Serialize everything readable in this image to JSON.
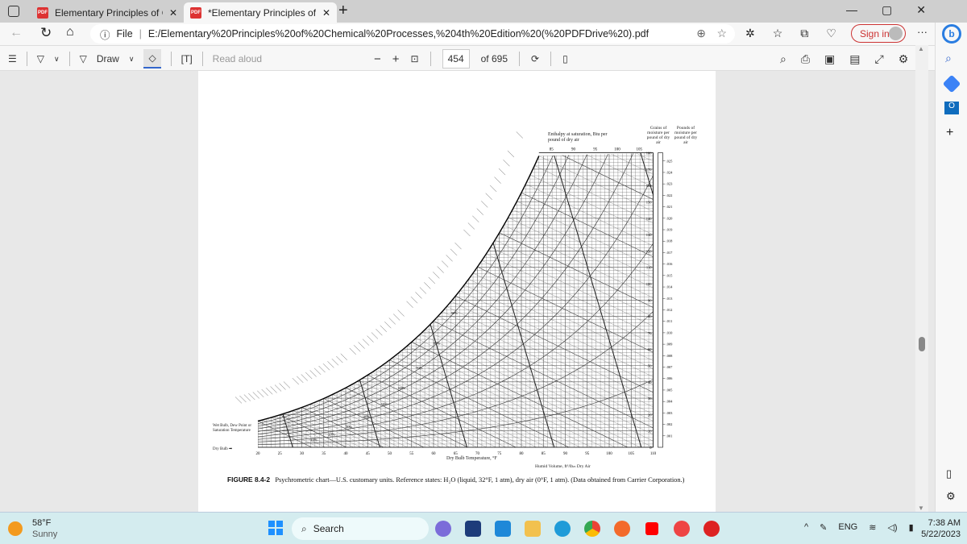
{
  "tabs": [
    {
      "label": "Elementary Principles of Chemica",
      "active": false
    },
    {
      "label": "*Elementary Principles of Chemic",
      "active": true
    }
  ],
  "address": {
    "prefix": "File",
    "url": "E:/Elementary%20Principles%20of%20Chemical%20Processes,%204th%20Edition%20(%20PDFDrive%20).pdf"
  },
  "toolbar": {
    "draw": "Draw",
    "read_aloud": "Read aloud",
    "page_current": "454",
    "page_total": "of 695",
    "minus": "−",
    "plus": "+"
  },
  "profile": {
    "sign_in": "Sign in",
    "more": "···"
  },
  "figure": {
    "caption_label": "FIGURE 8.4-2",
    "caption_text": "Psychrometric chart—U.S. customary units. Reference states: H₂O (liquid, 32°F, 1 atm), dry air (0°F, 1 atm). (Data obtained from Carrier Corporation.)",
    "enthalpy_label": "Enthalpy at saturation, Btu per pound of dry air",
    "grains_label": "Grains of moisture per pound of dry air",
    "pounds_label": "Pounds of moisture per pound of dry air",
    "x_label": "Dry Bulb Temperature, °F",
    "volume_label": "Humid Volume, ft³/lbₘ Dry Air",
    "dry_bulb": "Dry Bulb",
    "wet_bulb": "Wet Bulb, Dew Point or Saturation Temperature",
    "x_ticks": [
      "20",
      "25",
      "30",
      "35",
      "40",
      "45",
      "50",
      "55",
      "60",
      "65",
      "70",
      "75",
      "80",
      "85",
      "90",
      "95",
      "100",
      "105",
      "110"
    ],
    "top_ticks": [
      "85",
      "90",
      "95",
      "100",
      "105"
    ],
    "grain_ticks": [
      "0",
      "10",
      "20",
      "30",
      "40",
      "50",
      "60",
      "70",
      "80",
      "90",
      "100",
      "110",
      "120",
      "130",
      "140",
      "150",
      "160",
      "170",
      "180"
    ],
    "pound_ticks": [
      ".001",
      ".002",
      ".003",
      ".004",
      ".005",
      ".006",
      ".007",
      ".008",
      ".009",
      ".010",
      ".011",
      ".012",
      ".013",
      ".014",
      ".015",
      ".016",
      ".017",
      ".018",
      ".019",
      ".020",
      ".021",
      ".022",
      ".023",
      ".024",
      ".025"
    ],
    "rh_labels": [
      "10%",
      "20%",
      "30%",
      "40%",
      "50%",
      "60%",
      "70%",
      "80%",
      "90%"
    ]
  },
  "taskbar": {
    "temp": "58°F",
    "weather": "Sunny",
    "search": "Search",
    "lang": "ENG",
    "time": "7:38 AM",
    "date": "5/22/2023"
  }
}
